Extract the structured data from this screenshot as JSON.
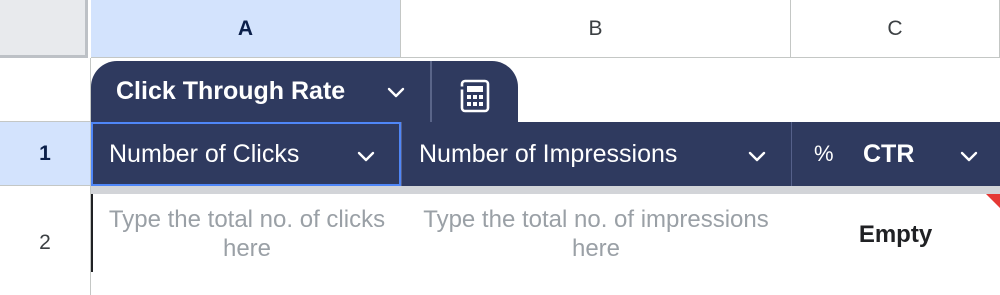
{
  "columns": {
    "a": "A",
    "b": "B",
    "c": "C"
  },
  "rows": {
    "r1": "1",
    "r2": "2"
  },
  "table": {
    "name": "Click Through Rate"
  },
  "headers": {
    "clicks": "Number of Clicks",
    "impressions": "Number of Impressions",
    "ctr_type": "%",
    "ctr": "CTR"
  },
  "row2": {
    "clicks_placeholder": "Type the total no. of clicks here",
    "impressions_placeholder": "Type the total no. of impressions here",
    "ctr_value": "Empty"
  },
  "icons": {
    "dropdown": "chevron-down-icon",
    "calculator": "calculator-icon"
  },
  "colors": {
    "table_header": "#2f3a5f",
    "selection": "#d3e3fd",
    "selection_border": "#4f86f7",
    "placeholder": "#9aa0a6",
    "comment_marker": "#e53935"
  }
}
